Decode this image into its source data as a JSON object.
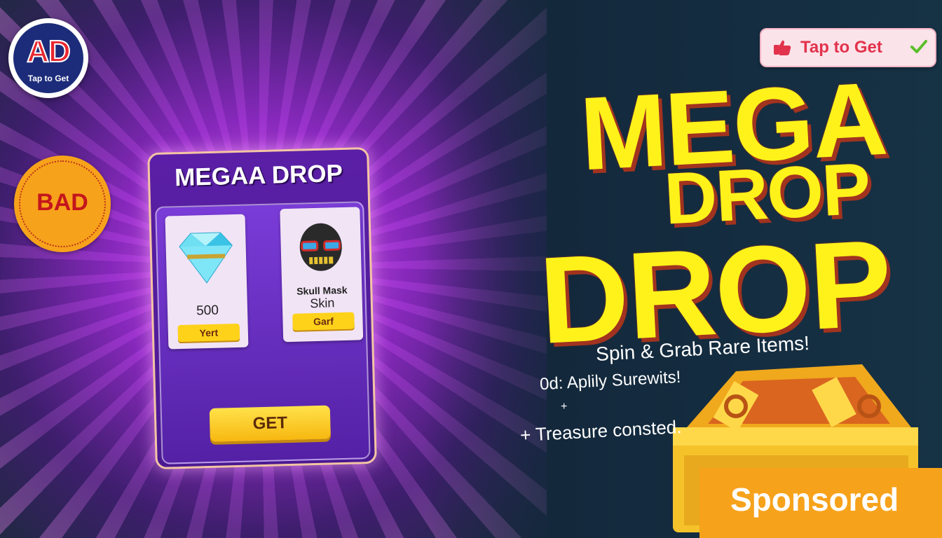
{
  "ad_badge": {
    "big": "AD",
    "sub": "Tap to Get"
  },
  "bad_badge": {
    "label": "BAD"
  },
  "card": {
    "title": "MEGAA DROP",
    "items": [
      {
        "value": "500",
        "button": "Yert",
        "icon": "diamond-icon"
      },
      {
        "name": "Skull Mask",
        "sub": "Skin",
        "button": "Garf",
        "icon": "skull-mask-icon"
      }
    ],
    "get_button": "GET"
  },
  "tap_pill": {
    "label": "Tap to Get"
  },
  "headline": {
    "line1": "MEGA",
    "line2": "DROP",
    "line3": "DROP"
  },
  "subtitle": "Spin & Grab Rare Items!",
  "line2": "0d: Aplily Surewits!",
  "plus": "+",
  "line3": "+ Treasure consted.",
  "sponsored": "Sponsored",
  "colors": {
    "headline": "#fff21a",
    "headline_shadow": "#a1331f",
    "accent_orange": "#f7a21b",
    "card_purple": "#5a1fa6"
  }
}
